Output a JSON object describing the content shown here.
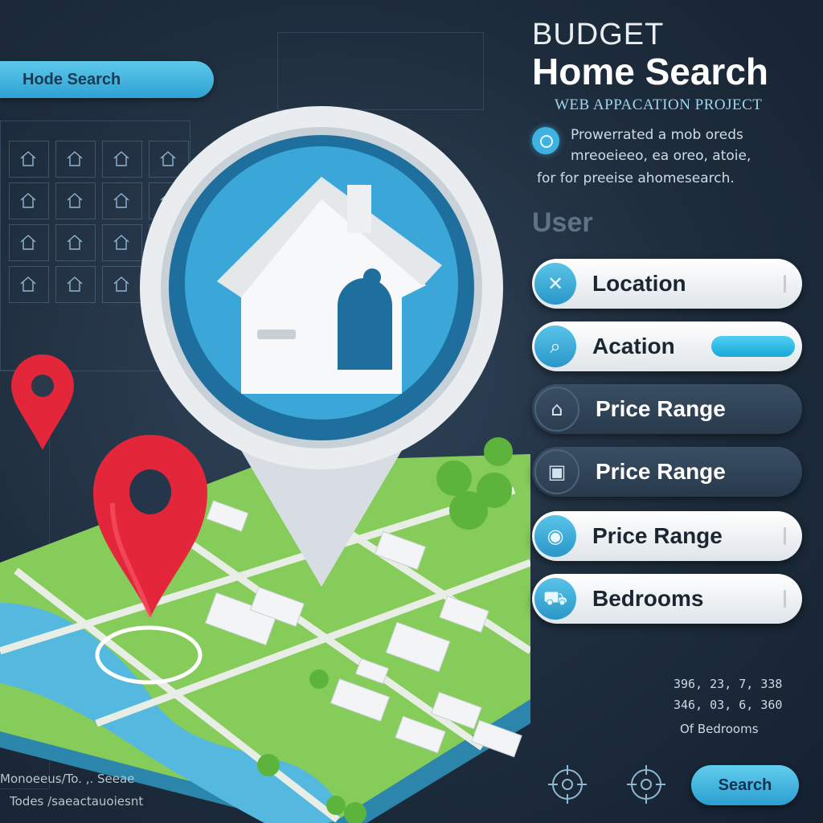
{
  "header": {
    "search_pill": "Hode Search",
    "title_small": "BUDGET",
    "title_big": "Home Search",
    "subtitle": "WEB APPACATION PROJECT",
    "description_lines": [
      "Prowerrated a mob oreds",
      "mreoeieeo, ea oreo, atoie,",
      "for for preeise ahomesearch."
    ],
    "user_label": "User"
  },
  "form": {
    "fields": [
      {
        "label": "Location",
        "icon": "location-icon",
        "style": "light"
      },
      {
        "label": "Acation",
        "icon": "search-icon",
        "style": "light"
      },
      {
        "label": "Price Range",
        "icon": "house-icon",
        "style": "dark"
      },
      {
        "label": "Price Range",
        "icon": "calculator-icon",
        "style": "dark"
      },
      {
        "label": "Price Range",
        "icon": "map-pin-icon",
        "style": "light"
      },
      {
        "label": "Bedrooms",
        "icon": "bed-icon",
        "style": "light"
      }
    ]
  },
  "stats": {
    "lines": [
      "396, 23, 7, 338",
      "346, 03, 6, 360",
      "Of Bedrooms"
    ]
  },
  "search_button": {
    "label": "Search"
  },
  "footer": {
    "lines": [
      "Monoeeus/To. ,. Seeae",
      "Todes /saeactauoiesnt"
    ]
  },
  "colors": {
    "accent": "#2fa2d2",
    "pin_red": "#e3263a",
    "map_green": "#7ac74f",
    "water": "#4fb3dc",
    "background": "#1e2d3d"
  }
}
